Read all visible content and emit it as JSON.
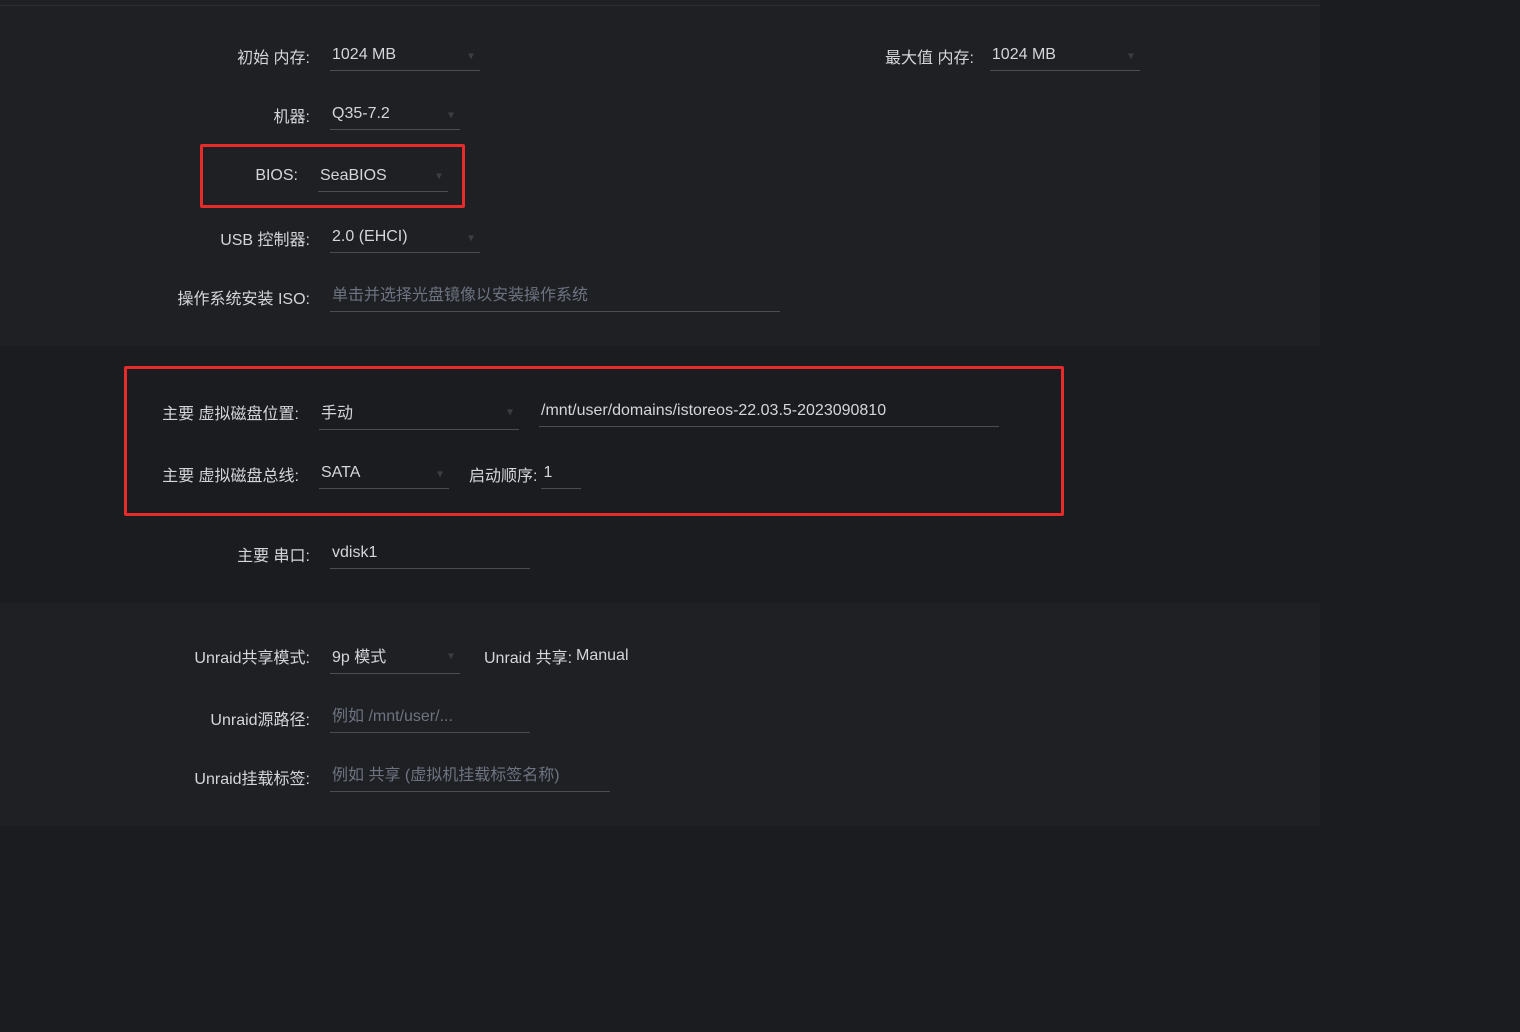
{
  "memory": {
    "initial_label": "初始 内存:",
    "initial_value": "1024 MB",
    "max_label": "最大值 内存:",
    "max_value": "1024 MB"
  },
  "machine": {
    "label": "机器:",
    "value": "Q35-7.2"
  },
  "bios": {
    "label": "BIOS:",
    "value": "SeaBIOS"
  },
  "usb_controller": {
    "label": "USB 控制器:",
    "value": "2.0 (EHCI)"
  },
  "os_iso": {
    "label": "操作系统安装 ISO:",
    "placeholder": "单击并选择光盘镜像以安装操作系统"
  },
  "vdisk": {
    "location_label": "主要 虚拟磁盘位置:",
    "location_mode": "手动",
    "location_path": "/mnt/user/domains/istoreos-22.03.5-2023090810",
    "bus_label": "主要 虚拟磁盘总线:",
    "bus_value": "SATA",
    "boot_order_label": "启动顺序:",
    "boot_order_value": "1",
    "serial_label": "主要 串口:",
    "serial_value": "vdisk1"
  },
  "unraid_share": {
    "mode_label": "Unraid共享模式:",
    "mode_value": "9p 模式",
    "share_inline_label": "Unraid 共享:",
    "share_inline_value": "Manual",
    "source_label": "Unraid源路径:",
    "source_placeholder": "例如 /mnt/user/...",
    "tag_label": "Unraid挂载标签:",
    "tag_placeholder": "例如 共享 (虚拟机挂载标签名称)"
  }
}
